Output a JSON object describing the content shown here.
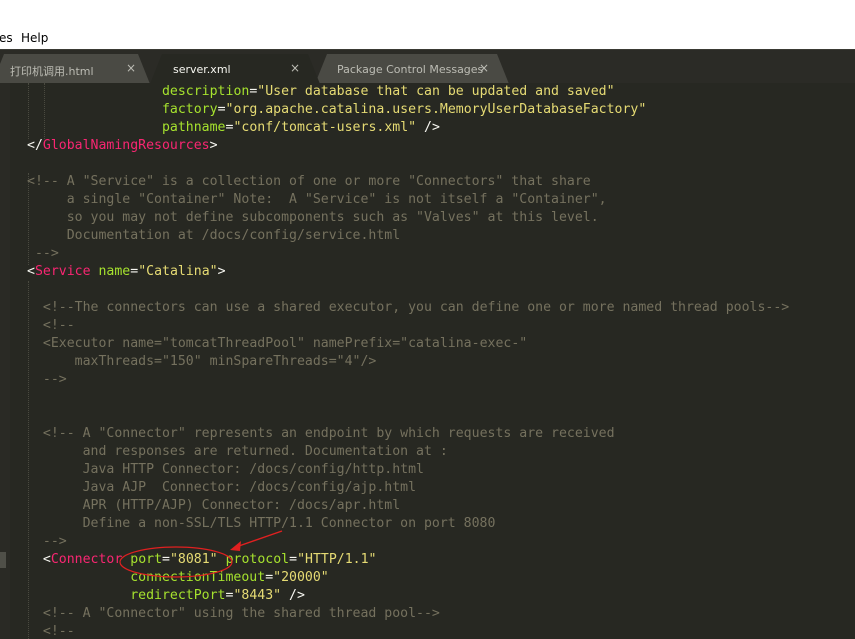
{
  "menubar": {
    "items": [
      {
        "label": "es"
      },
      {
        "label": "Help"
      }
    ]
  },
  "tabs": [
    {
      "label": "打印机调用.html",
      "close": "×"
    },
    {
      "label": "server.xml",
      "close": "×"
    },
    {
      "label": "Package Control Messages",
      "close": "×"
    }
  ],
  "code_lines": [
    "description=\"User database that can be updated and saved\"",
    "factory=\"org.apache.catalina.users.MemoryUserDatabaseFactory\"",
    "pathname=\"conf/tomcat-users.xml\" />",
    "</GlobalNamingResources>",
    "",
    "<!-- A \"Service\" is a collection of one or more \"Connectors\" that share",
    "a single \"Container\" Note:  A \"Service\" is not itself a \"Container\",",
    "so you may not define subcomponents such as \"Valves\" at this level.",
    "Documentation at /docs/config/service.html",
    "-->",
    "<Service name=\"Catalina\">",
    "",
    "<!--The connectors can use a shared executor, you can define one or more named thread pools-->",
    "<!--",
    "<Executor name=\"tomcatThreadPool\" namePrefix=\"catalina-exec-\"",
    "maxThreads=\"150\" minSpareThreads=\"4\"/>",
    "-->",
    "",
    "",
    "<!-- A \"Connector\" represents an endpoint by which requests are received",
    "and responses are returned. Documentation at :",
    "Java HTTP Connector: /docs/config/http.html",
    "Java AJP  Connector: /docs/config/ajp.html",
    "APR (HTTP/AJP) Connector: /docs/apr.html",
    "Define a non-SSL/TLS HTTP/1.1 Connector on port 8080",
    "-->",
    "<Connector port=\"8081\" protocol=\"HTTP/1.1\"",
    "connectionTimeout=\"20000\"",
    "redirectPort=\"8443\" />",
    "<!-- A \"Connector\" using the shared thread pool-->",
    "<!--"
  ],
  "colors": {
    "background": "#272822",
    "tag": "#f92672",
    "attribute": "#a6e22e",
    "string": "#e6db74",
    "comment": "#75715e",
    "annotation": "#e02020"
  }
}
